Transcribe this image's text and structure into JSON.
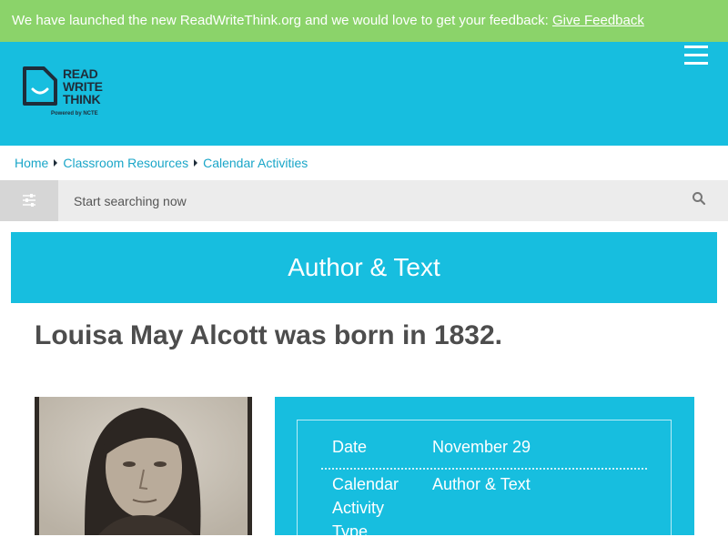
{
  "banner": {
    "message": "We have launched the new ReadWriteThink.org and we would love to get your feedback:",
    "link_label": "Give Feedback"
  },
  "header": {
    "logo": {
      "line1": "READ",
      "line2": "WRITE",
      "line3": "THINK",
      "powered_by": "Powered by NCTE"
    },
    "menu_icon": "hamburger-menu-icon"
  },
  "breadcrumb": {
    "items": [
      "Home",
      "Classroom Resources",
      "Calendar Activities"
    ]
  },
  "search": {
    "placeholder": "Start searching now",
    "filter_icon": "sliders-icon",
    "search_icon": "magnifier-icon"
  },
  "category": {
    "title": "Author & Text"
  },
  "page": {
    "title": "Louisa May Alcott was born in 1832."
  },
  "details": {
    "date_label": "Date",
    "date_value": "November 29",
    "type_label_1": "Calendar",
    "type_label_2": "Activity",
    "type_label_3": "Type",
    "type_value": "Author & Text"
  },
  "colors": {
    "banner": "#8bd36a",
    "brand": "#17bedf",
    "link": "#1aa6c8",
    "title_text": "#4d4d4d"
  }
}
